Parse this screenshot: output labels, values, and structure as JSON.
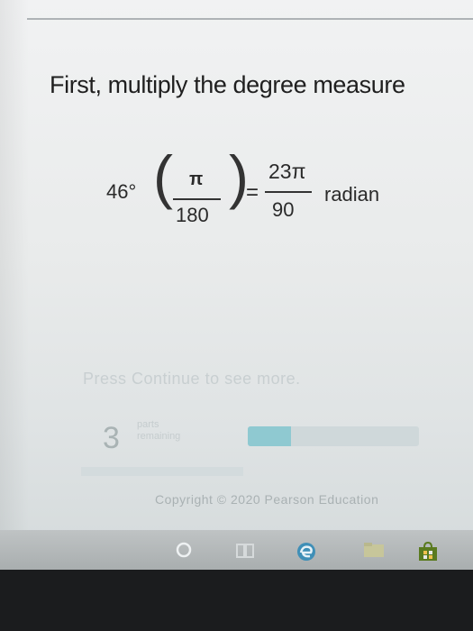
{
  "heading": "First, multiply the degree measure",
  "equation": {
    "degree": "46°",
    "fraction1_numerator": "π",
    "fraction1_denominator": "180",
    "equals": "=",
    "fraction2_numerator": "23π",
    "fraction2_denominator": "90",
    "unit": "radian"
  },
  "prompt": "Press Continue to see more.",
  "parts": {
    "count": "3",
    "label_line1": "parts",
    "label_line2": "remaining",
    "progress_fraction": 0.25
  },
  "copyright": "Copyright © 2020 Pearson Education",
  "taskbar": {
    "icons": [
      "search-circle-icon",
      "task-view-icon",
      "edge-icon",
      "file-explorer-icon",
      "store-icon"
    ]
  }
}
